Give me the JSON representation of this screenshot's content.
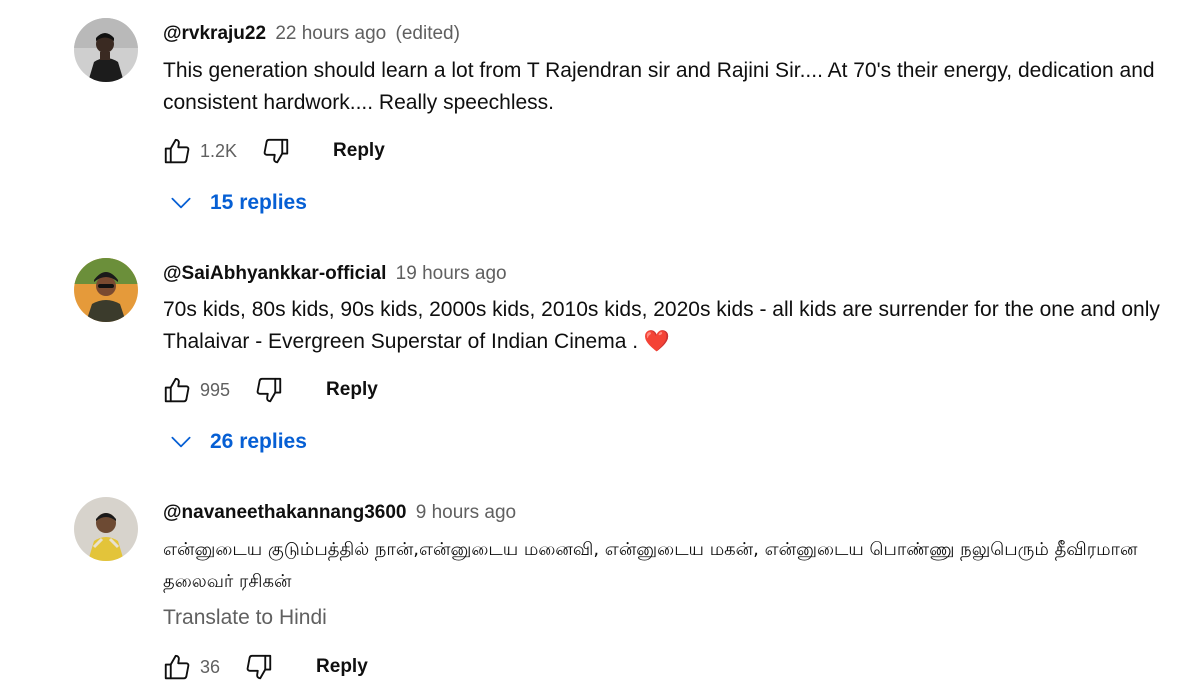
{
  "comments": [
    {
      "author": "@rvkraju22",
      "time": "22 hours ago",
      "edited": "(edited)",
      "text": "This generation should  learn a lot from T Rajendran sir and Rajini Sir.... At 70's their energy, dedication and consistent hardwork.... Really speechless.",
      "likes": "1.2K",
      "reply_label": "Reply",
      "replies_label": "15 replies"
    },
    {
      "author": "@SaiAbhyankkar-official",
      "time": "19 hours ago",
      "text": "70s kids, 80s kids, 90s kids, 2000s kids, 2010s kids, 2020s kids - all kids are surrender for the one and only Thalaivar - Evergreen Superstar of Indian Cinema . ❤️",
      "likes": "995",
      "reply_label": "Reply",
      "replies_label": "26 replies"
    },
    {
      "author": "@navaneethakannang3600",
      "time": "9 hours ago",
      "text": "என்னுடைய குடும்பத்தில்  நான்,என்னுடைய மனைவி, என்னுடைய மகன், என்னுடைய பொண்ணு நலுபெரும் தீவிரமான தலைவர் ரசிகன்",
      "translate_label": "Translate to Hindi",
      "likes": "36",
      "reply_label": "Reply"
    }
  ],
  "icons": {
    "like": "thumbs-up-icon",
    "dislike": "thumbs-down-icon",
    "expand": "chevron-down-icon"
  },
  "colors": {
    "text": "#0f0f0f",
    "secondary": "#606060",
    "link": "#065fd4"
  }
}
